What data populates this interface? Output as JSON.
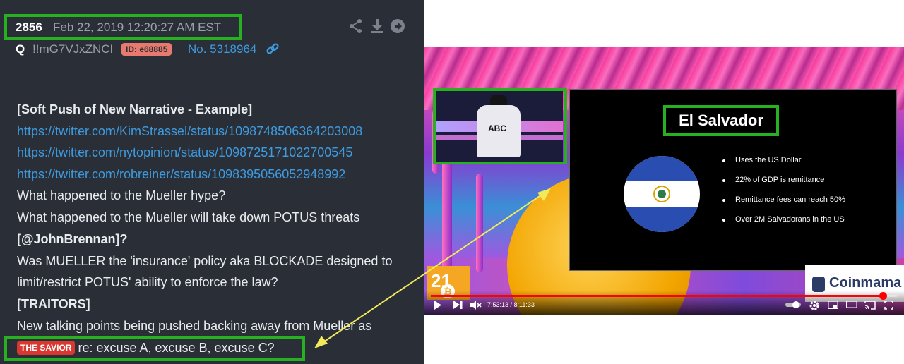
{
  "post": {
    "number": "2856",
    "date": "Feb 22, 2019 12:20:27 AM EST",
    "author": "Q",
    "tripcode": "!!mG7VJxZNCI",
    "id_badge": "ID: e68885",
    "post_no": "No. 5318964",
    "icons": [
      "share-icon",
      "download-icon",
      "forward-icon",
      "link-icon"
    ],
    "lines": [
      "[Soft Push of New Narrative - Example]",
      "https://twitter.com/KimStrassel/status/1098748506364203008",
      "https://twitter.com/nytopinion/status/1098725171022700545",
      "https://twitter.com/robreiner/status/1098395056052948992",
      "What happened to the Mueller hype?",
      "What happened to the Mueller will take down POTUS threats",
      "[@JohnBrennan]?",
      "Was MUELLER the 'insurance' policy aka BLOCKADE designed to",
      "limit/restrict POTUS' ability to enforce the law?",
      "[TRAITORS]",
      "New talking points being pushed backing away from Mueller as"
    ],
    "savior_badge": "THE SAVIOR",
    "last_line": "re: excuse A, excuse B, excuse C?",
    "colors": {
      "background": "#2a2f37",
      "link": "#3e9be0",
      "highlight": "#27b01f",
      "badge_red": "#d9372f"
    }
  },
  "video": {
    "slide_title": "El Salvador",
    "bullets": [
      "Uses the US Dollar",
      "22% of GDP is remittance",
      "Remittance fees can reach 50%",
      "Over 2M Salvadorans in the US"
    ],
    "speaker_shirt": "ABC",
    "time": "7:53:13 / 8:11:33",
    "progress": 0.97,
    "logo_left": "21",
    "logo_right": "Coinmama",
    "controls": [
      "play-icon",
      "next-icon",
      "mute-icon",
      "autoplay-toggle",
      "settings-icon",
      "miniplayer-icon",
      "theater-icon",
      "cast-icon",
      "fullscreen-icon"
    ]
  }
}
